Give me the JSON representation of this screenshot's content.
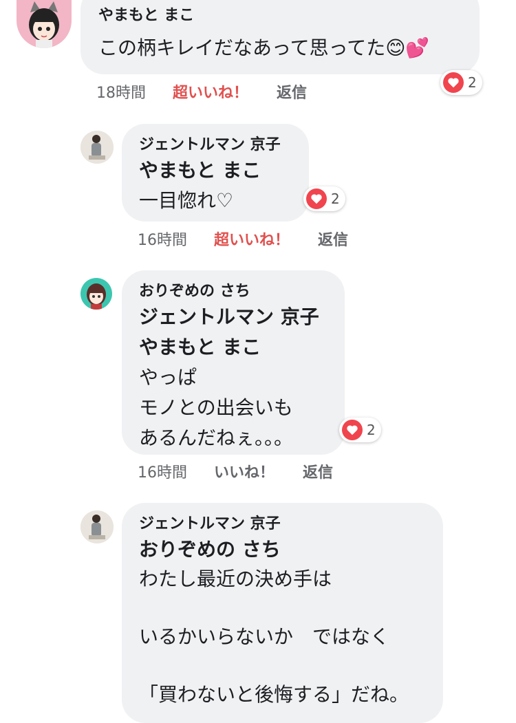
{
  "comments": [
    {
      "author": "やまもと まこ",
      "mentions": [],
      "text": "この柄キレイだなあって思ってた😊💕",
      "time": "18時間",
      "like_label": "超いいね！",
      "reply_label": "返信",
      "reactions": "2"
    },
    {
      "author": "ジェントルマン 京子",
      "mentions": [
        "やまもと まこ"
      ],
      "text": "一目惚れ♡",
      "time": "16時間",
      "like_label": "超いいね！",
      "reply_label": "返信",
      "reactions": "2"
    },
    {
      "author": "おりぞめの さち",
      "mentions": [
        "ジェントルマン 京子",
        "やまもと まこ"
      ],
      "text": "やっぱ\nモノとの出会いも\nあるんだねぇ。。。",
      "time": "16時間",
      "like_label": "いいね！",
      "reply_label": "返信",
      "reactions": "2"
    },
    {
      "author": "ジェントルマン 京子",
      "mentions": [
        "おりぞめの さち"
      ],
      "text": "わたし最近の決め手は\n\nいるかいらないか　ではなく\n\n「買わないと後悔する」だね。",
      "time": "",
      "like_label": "",
      "reply_label": "",
      "reactions": ""
    }
  ],
  "colors": {
    "bubble": "#f0f1f3",
    "liked": "#e0504e",
    "heart": "#f0454e",
    "meta": "#65676b"
  }
}
